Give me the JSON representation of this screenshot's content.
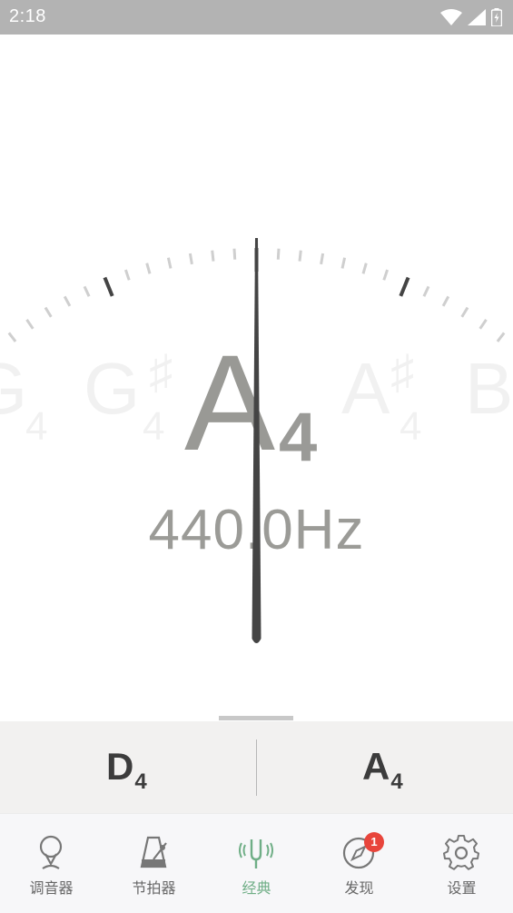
{
  "status_bar": {
    "time": "2:18",
    "icons": [
      "wifi-icon",
      "signal-icon",
      "battery-charging-icon"
    ]
  },
  "tuner": {
    "notes": {
      "far_left": {
        "letter": "G",
        "octave": "4"
      },
      "left": {
        "letter": "G",
        "octave": "4",
        "sharp": "♯"
      },
      "current": {
        "letter": "A",
        "octave": "4"
      },
      "right": {
        "letter": "A",
        "octave": "4",
        "sharp": "♯"
      },
      "far_right": {
        "letter": "B",
        "octave": ""
      }
    },
    "frequency": "440.0Hz",
    "needle_offset_cents": 0
  },
  "strings": {
    "left": {
      "letter": "D",
      "octave": "4"
    },
    "right": {
      "letter": "A",
      "octave": "4"
    }
  },
  "tabbar": {
    "tabs": [
      {
        "label": "调音器",
        "icon": "tuner-pin-icon",
        "active": false
      },
      {
        "label": "节拍器",
        "icon": "metronome-icon",
        "active": false
      },
      {
        "label": "经典",
        "icon": "tuning-fork-icon",
        "active": true
      },
      {
        "label": "发现",
        "icon": "compass-icon",
        "active": false,
        "badge": "1"
      },
      {
        "label": "设置",
        "icon": "gear-icon",
        "active": false
      }
    ]
  },
  "colors": {
    "status_bar": "#b3b3b3",
    "accent": "#6fae86",
    "badge": "#e8453c",
    "needle": "#444444"
  }
}
